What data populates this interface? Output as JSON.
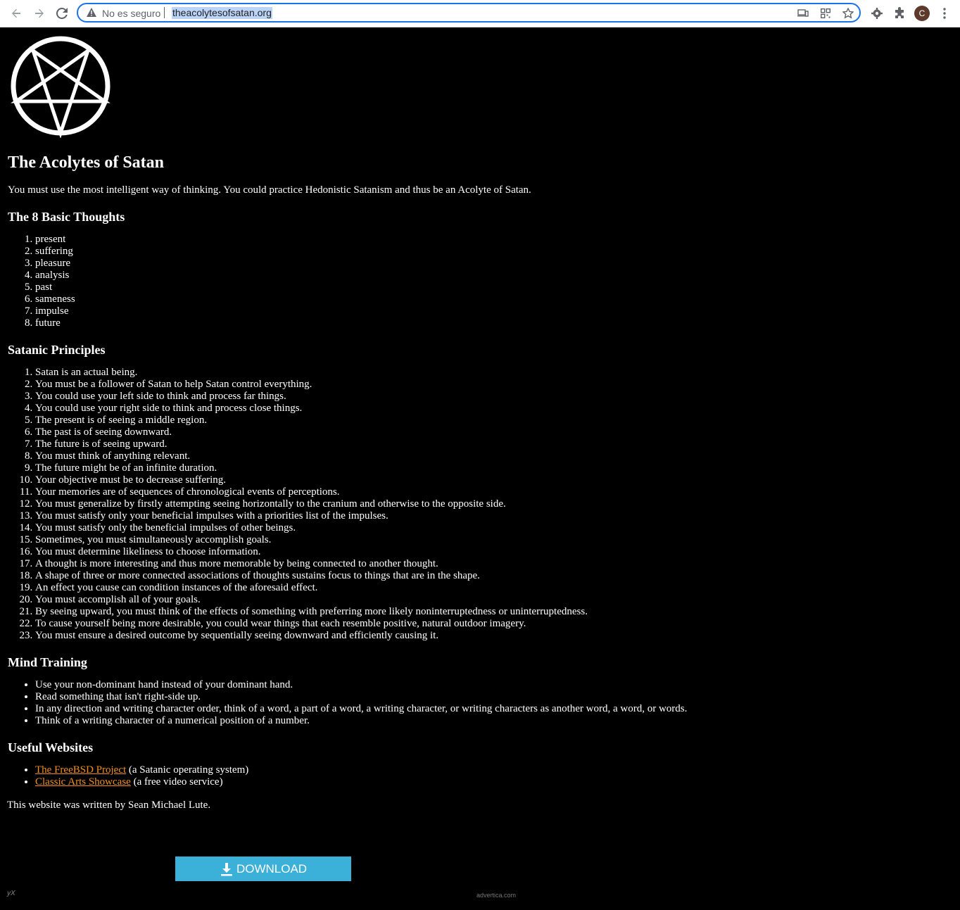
{
  "browser": {
    "security_status": "No es seguro",
    "url": "theacolytesofsatan.org",
    "avatar_letter": "C"
  },
  "page": {
    "title": "The Acolytes of Satan",
    "intro": "You must use the most intelligent way of thinking. You could practice Hedonistic Satanism and thus be an Acolyte of Satan.",
    "basic_thoughts": {
      "heading": "The 8 Basic Thoughts",
      "items": [
        "present",
        "suffering",
        "pleasure",
        "analysis",
        "past",
        "sameness",
        "impulse",
        "future"
      ]
    },
    "principles": {
      "heading": "Satanic Principles",
      "items": [
        "Satan is an actual being.",
        "You must be a follower of Satan to help Satan control everything.",
        "You could use your left side to think and process far things.",
        "You could use your right side to think and process close things.",
        "The present is of seeing a middle region.",
        "The past is of seeing downward.",
        "The future is of seeing upward.",
        "You must think of anything relevant.",
        "The future might be of an infinite duration.",
        "Your objective must be to decrease suffering.",
        "Your memories are of sequences of chronological events of perceptions.",
        "You must generalize by firstly attempting seeing horizontally to the cranium and otherwise to the opposite side.",
        "You must satisfy only your beneficial impulses with a priorities list of the impulses.",
        "You must satisfy only the beneficial impulses of other beings.",
        "Sometimes, you must simultaneously accomplish goals.",
        "You must determine likeliness to choose information.",
        "A thought is more interesting and thus more memorable by being connected to another thought.",
        "A shape of three or more connected associations of thoughts sustains focus to things that are in the shape.",
        "An effect you cause can condition instances of the aforesaid effect.",
        "You must accomplish all of your goals.",
        "By seeing upward, you must think of the effects of something with preferring more likely noninterruptedness or uninterruptedness.",
        "To cause yourself being more desirable, you could wear things that each resemble positive, natural outdoor imagery.",
        "You must ensure a desired outcome by sequentially seeing downward and efficiently causing it."
      ]
    },
    "mind_training": {
      "heading": "Mind Training",
      "items": [
        "Use your non-dominant hand instead of your dominant hand.",
        "Read something that isn't right-side up.",
        "In any direction and writing character order, think of a word, a part of a word, a writing character, or writing characters as another word, a word, or words.",
        "Think of a writing character of a numerical position of a number."
      ]
    },
    "websites": {
      "heading": "Useful Websites",
      "items": [
        {
          "link": "The FreeBSD Project",
          "note": " (a Satanic operating system)"
        },
        {
          "link": "Classic Arts Showcase",
          "note": " (a free video service)"
        }
      ]
    },
    "footer": "This website was written by Sean Michael Lute."
  },
  "ad": {
    "button_label": "DOWNLOAD",
    "source": "advertica.com",
    "mark": "yX"
  },
  "colors": {
    "link": "#f0901c",
    "download_button": "#3bb0d9",
    "omnibox_border": "#1a73e8"
  }
}
